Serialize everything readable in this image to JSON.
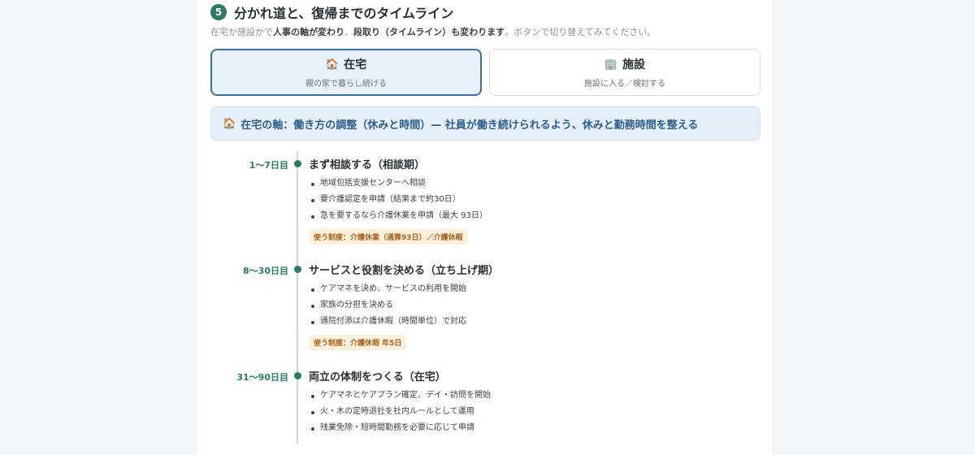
{
  "section": {
    "number": "5",
    "title": "分かれ道と、復帰までのタイムライン",
    "lead_pre": "在宅か施設かで",
    "lead_b1": "人事の軸が変わり",
    "lead_mid": "、",
    "lead_b2": "段取り（タイムライン）も変わります",
    "lead_post": "。ボタンで切り替えてみてください。"
  },
  "toggles": [
    {
      "icon": "🏠",
      "label": "在宅",
      "sub": "親の家で暮らし続ける",
      "active": true
    },
    {
      "icon": "🏢",
      "label": "施設",
      "sub": "施設に入る／検討する",
      "active": false
    }
  ],
  "banner": {
    "icon": "🏠",
    "text": "在宅の軸：働き方の調整（休みと時間）— 社員が働き続けられるよう、休みと勤務時間を整える"
  },
  "phases": [
    {
      "day": "1〜7日目",
      "title": "まず相談する（相談期）",
      "items": [
        "地域包括支援センターへ相談",
        "要介護認定を申請（結果まで約30日）",
        "急を要するなら介護休業を申請（最大 93日）"
      ],
      "tag": "使う制度：介護休業（通算93日）／介護休暇"
    },
    {
      "day": "8〜30日目",
      "title": "サービスと役割を決める（立ち上げ期）",
      "items": [
        "ケアマネを決め、サービスの利用を開始",
        "家族の分担を決める",
        "通院付添は介護休暇（時間単位）で対応"
      ],
      "tag": "使う制度：介護休暇 年5日"
    },
    {
      "day": "31〜90日目",
      "title": "両立の体制をつくる（在宅）",
      "items": [
        "ケアマネとケアプラン確定、デイ・訪問を開始",
        "火・木の定時退社を社内ルールとして運用",
        "残業免除・短時間勤務を必要に応じて申請"
      ],
      "tag": ""
    }
  ],
  "colors": {
    "accent": "#2e7a68",
    "banner_text": "#2f5e8c",
    "tag_bg": "#fdf0dc",
    "tag_text": "#a4621d"
  }
}
